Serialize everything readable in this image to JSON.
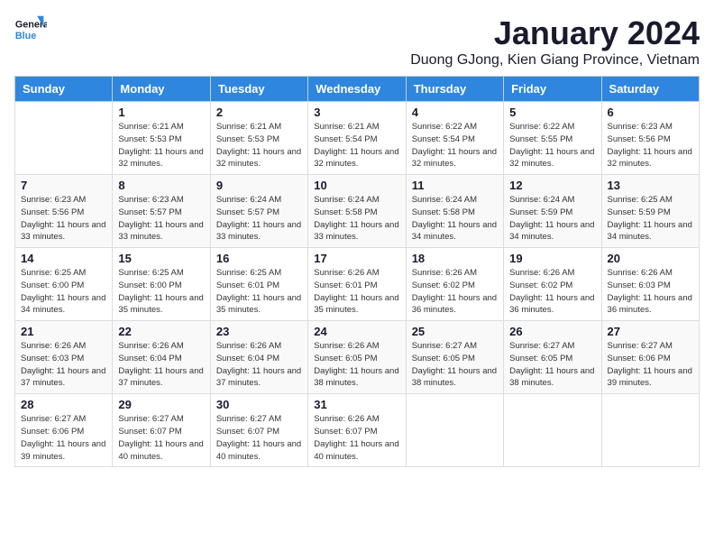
{
  "logo": {
    "line1": "General",
    "line2": "Blue"
  },
  "title": "January 2024",
  "location": "Duong GJong, Kien Giang Province, Vietnam",
  "headers": [
    "Sunday",
    "Monday",
    "Tuesday",
    "Wednesday",
    "Thursday",
    "Friday",
    "Saturday"
  ],
  "weeks": [
    [
      {
        "day": "",
        "sunrise": "",
        "sunset": "",
        "daylight": ""
      },
      {
        "day": "1",
        "sunrise": "Sunrise: 6:21 AM",
        "sunset": "Sunset: 5:53 PM",
        "daylight": "Daylight: 11 hours and 32 minutes."
      },
      {
        "day": "2",
        "sunrise": "Sunrise: 6:21 AM",
        "sunset": "Sunset: 5:53 PM",
        "daylight": "Daylight: 11 hours and 32 minutes."
      },
      {
        "day": "3",
        "sunrise": "Sunrise: 6:21 AM",
        "sunset": "Sunset: 5:54 PM",
        "daylight": "Daylight: 11 hours and 32 minutes."
      },
      {
        "day": "4",
        "sunrise": "Sunrise: 6:22 AM",
        "sunset": "Sunset: 5:54 PM",
        "daylight": "Daylight: 11 hours and 32 minutes."
      },
      {
        "day": "5",
        "sunrise": "Sunrise: 6:22 AM",
        "sunset": "Sunset: 5:55 PM",
        "daylight": "Daylight: 11 hours and 32 minutes."
      },
      {
        "day": "6",
        "sunrise": "Sunrise: 6:23 AM",
        "sunset": "Sunset: 5:56 PM",
        "daylight": "Daylight: 11 hours and 32 minutes."
      }
    ],
    [
      {
        "day": "7",
        "sunrise": "Sunrise: 6:23 AM",
        "sunset": "Sunset: 5:56 PM",
        "daylight": "Daylight: 11 hours and 33 minutes."
      },
      {
        "day": "8",
        "sunrise": "Sunrise: 6:23 AM",
        "sunset": "Sunset: 5:57 PM",
        "daylight": "Daylight: 11 hours and 33 minutes."
      },
      {
        "day": "9",
        "sunrise": "Sunrise: 6:24 AM",
        "sunset": "Sunset: 5:57 PM",
        "daylight": "Daylight: 11 hours and 33 minutes."
      },
      {
        "day": "10",
        "sunrise": "Sunrise: 6:24 AM",
        "sunset": "Sunset: 5:58 PM",
        "daylight": "Daylight: 11 hours and 33 minutes."
      },
      {
        "day": "11",
        "sunrise": "Sunrise: 6:24 AM",
        "sunset": "Sunset: 5:58 PM",
        "daylight": "Daylight: 11 hours and 34 minutes."
      },
      {
        "day": "12",
        "sunrise": "Sunrise: 6:24 AM",
        "sunset": "Sunset: 5:59 PM",
        "daylight": "Daylight: 11 hours and 34 minutes."
      },
      {
        "day": "13",
        "sunrise": "Sunrise: 6:25 AM",
        "sunset": "Sunset: 5:59 PM",
        "daylight": "Daylight: 11 hours and 34 minutes."
      }
    ],
    [
      {
        "day": "14",
        "sunrise": "Sunrise: 6:25 AM",
        "sunset": "Sunset: 6:00 PM",
        "daylight": "Daylight: 11 hours and 34 minutes."
      },
      {
        "day": "15",
        "sunrise": "Sunrise: 6:25 AM",
        "sunset": "Sunset: 6:00 PM",
        "daylight": "Daylight: 11 hours and 35 minutes."
      },
      {
        "day": "16",
        "sunrise": "Sunrise: 6:25 AM",
        "sunset": "Sunset: 6:01 PM",
        "daylight": "Daylight: 11 hours and 35 minutes."
      },
      {
        "day": "17",
        "sunrise": "Sunrise: 6:26 AM",
        "sunset": "Sunset: 6:01 PM",
        "daylight": "Daylight: 11 hours and 35 minutes."
      },
      {
        "day": "18",
        "sunrise": "Sunrise: 6:26 AM",
        "sunset": "Sunset: 6:02 PM",
        "daylight": "Daylight: 11 hours and 36 minutes."
      },
      {
        "day": "19",
        "sunrise": "Sunrise: 6:26 AM",
        "sunset": "Sunset: 6:02 PM",
        "daylight": "Daylight: 11 hours and 36 minutes."
      },
      {
        "day": "20",
        "sunrise": "Sunrise: 6:26 AM",
        "sunset": "Sunset: 6:03 PM",
        "daylight": "Daylight: 11 hours and 36 minutes."
      }
    ],
    [
      {
        "day": "21",
        "sunrise": "Sunrise: 6:26 AM",
        "sunset": "Sunset: 6:03 PM",
        "daylight": "Daylight: 11 hours and 37 minutes."
      },
      {
        "day": "22",
        "sunrise": "Sunrise: 6:26 AM",
        "sunset": "Sunset: 6:04 PM",
        "daylight": "Daylight: 11 hours and 37 minutes."
      },
      {
        "day": "23",
        "sunrise": "Sunrise: 6:26 AM",
        "sunset": "Sunset: 6:04 PM",
        "daylight": "Daylight: 11 hours and 37 minutes."
      },
      {
        "day": "24",
        "sunrise": "Sunrise: 6:26 AM",
        "sunset": "Sunset: 6:05 PM",
        "daylight": "Daylight: 11 hours and 38 minutes."
      },
      {
        "day": "25",
        "sunrise": "Sunrise: 6:27 AM",
        "sunset": "Sunset: 6:05 PM",
        "daylight": "Daylight: 11 hours and 38 minutes."
      },
      {
        "day": "26",
        "sunrise": "Sunrise: 6:27 AM",
        "sunset": "Sunset: 6:05 PM",
        "daylight": "Daylight: 11 hours and 38 minutes."
      },
      {
        "day": "27",
        "sunrise": "Sunrise: 6:27 AM",
        "sunset": "Sunset: 6:06 PM",
        "daylight": "Daylight: 11 hours and 39 minutes."
      }
    ],
    [
      {
        "day": "28",
        "sunrise": "Sunrise: 6:27 AM",
        "sunset": "Sunset: 6:06 PM",
        "daylight": "Daylight: 11 hours and 39 minutes."
      },
      {
        "day": "29",
        "sunrise": "Sunrise: 6:27 AM",
        "sunset": "Sunset: 6:07 PM",
        "daylight": "Daylight: 11 hours and 40 minutes."
      },
      {
        "day": "30",
        "sunrise": "Sunrise: 6:27 AM",
        "sunset": "Sunset: 6:07 PM",
        "daylight": "Daylight: 11 hours and 40 minutes."
      },
      {
        "day": "31",
        "sunrise": "Sunrise: 6:26 AM",
        "sunset": "Sunset: 6:07 PM",
        "daylight": "Daylight: 11 hours and 40 minutes."
      },
      {
        "day": "",
        "sunrise": "",
        "sunset": "",
        "daylight": ""
      },
      {
        "day": "",
        "sunrise": "",
        "sunset": "",
        "daylight": ""
      },
      {
        "day": "",
        "sunrise": "",
        "sunset": "",
        "daylight": ""
      }
    ]
  ]
}
